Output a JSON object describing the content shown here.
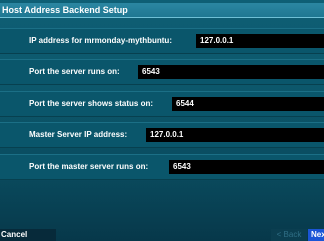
{
  "window": {
    "title": "Host Address Backend Setup"
  },
  "fields": [
    {
      "label": "IP address for mrmonday-mythbuntu:",
      "value": "127.0.0.1"
    },
    {
      "label": "Port the server runs on:",
      "value": "6543"
    },
    {
      "label": "Port the server shows status on:",
      "value": "6544"
    },
    {
      "label": "Master Server IP address:",
      "value": "127.0.0.1"
    },
    {
      "label": "Port the master server runs on:",
      "value": "6543"
    }
  ],
  "buttons": {
    "cancel_label": "Cancel",
    "back_label": "< Back",
    "next_label": "Next"
  },
  "colors": {
    "background": "#0c566a",
    "title_bar": "#1f7792",
    "input_bg": "#000000",
    "text": "#ffffff",
    "next_button": "#1a55d6"
  }
}
